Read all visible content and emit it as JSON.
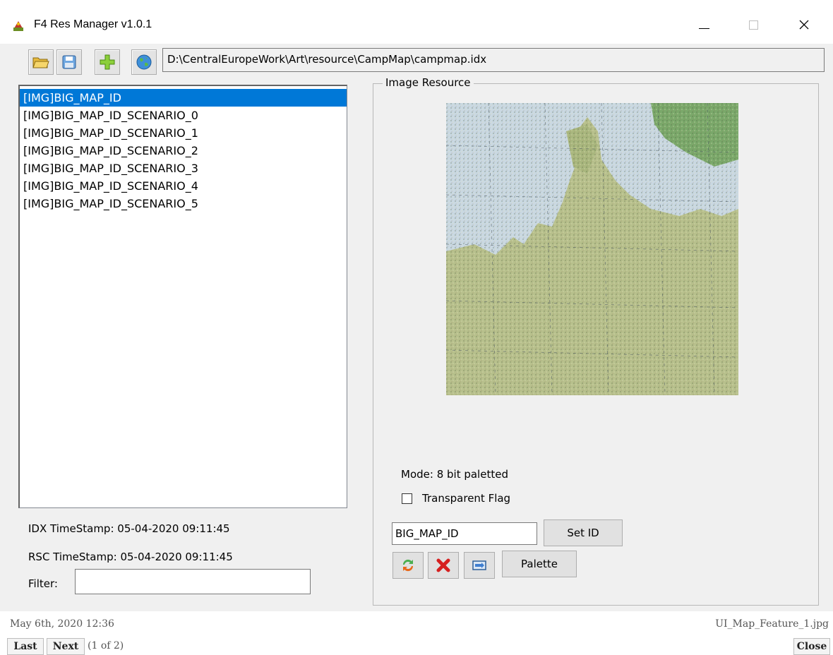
{
  "window": {
    "title": "F4 Res Manager v1.0.1",
    "minimize_glyph": "—",
    "maximize_glyph": "☐",
    "close_glyph": "✕"
  },
  "toolbar": {
    "icons": [
      "folder-open-icon",
      "save-icon",
      "add-icon",
      "globe-icon"
    ],
    "path": "D:\\CentralEuropeWork\\Art\\resource\\CampMap\\campmap.idx"
  },
  "resources": {
    "items": [
      "[IMG]BIG_MAP_ID",
      "[IMG]BIG_MAP_ID_SCENARIO_0",
      "[IMG]BIG_MAP_ID_SCENARIO_1",
      "[IMG]BIG_MAP_ID_SCENARIO_2",
      "[IMG]BIG_MAP_ID_SCENARIO_3",
      "[IMG]BIG_MAP_ID_SCENARIO_4",
      "[IMG]BIG_MAP_ID_SCENARIO_5"
    ],
    "selected_index": 0
  },
  "info": {
    "idx_timestamp": "IDX TimeStamp: 05-04-2020 09:11:45",
    "rsc_timestamp": "RSC TimeStamp: 05-04-2020 09:11:45",
    "filter_label": "Filter:",
    "filter_value": ""
  },
  "image_resource": {
    "group_title": "Image Resource",
    "mode": "Mode: 8 bit paletted",
    "transparent_label": "Transparent Flag",
    "transparent_checked": false,
    "id_value": "BIG_MAP_ID",
    "set_id_label": "Set ID",
    "palette_label": "Palette",
    "action_icons": [
      "refresh-icon",
      "delete-icon",
      "export-icon"
    ]
  },
  "viewer": {
    "date": "May 6th, 2020 12:36",
    "filename": "UI_Map_Feature_1.jpg",
    "last_label": "Last",
    "next_label": "Next",
    "page_indicator": "(1 of 2)",
    "close_label": "Close"
  },
  "colors": {
    "selection": "#0078d7",
    "sea": "#c9d8e2",
    "land": "#b7c08c",
    "forest": "#7aa86a"
  }
}
